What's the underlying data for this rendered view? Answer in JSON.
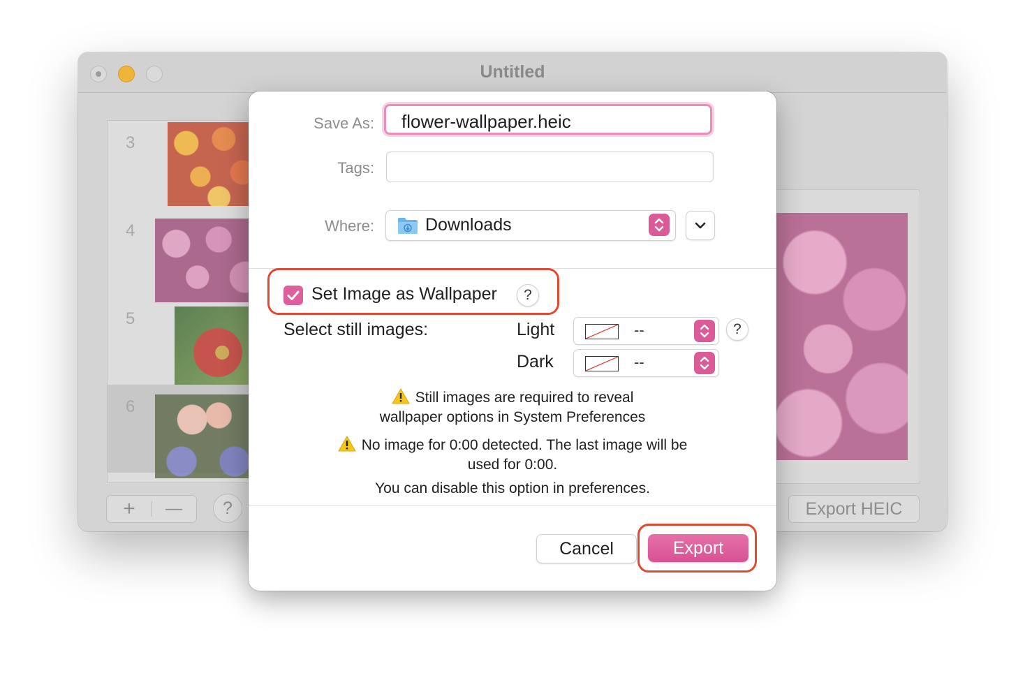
{
  "window": {
    "title": "Untitled",
    "thumbnails": [
      {
        "number": "3"
      },
      {
        "number": "4"
      },
      {
        "number": "5"
      },
      {
        "number": "6"
      }
    ],
    "add_label": "+",
    "remove_label": "—",
    "help_label": "?",
    "export_heic_label": "Export HEIC"
  },
  "dialog": {
    "save_as_label": "Save As:",
    "save_as_value": "flower-wallpaper.heic",
    "tags_label": "Tags:",
    "tags_value": "",
    "where_label": "Where:",
    "where_value": "Downloads",
    "set_wallpaper_label": "Set Image as Wallpaper",
    "set_wallpaper_checked": true,
    "help_label": "?",
    "select_still_label": "Select still images:",
    "light_label": "Light",
    "light_value": "--",
    "dark_label": "Dark",
    "dark_value": "--",
    "warning1_line1": "Still images are required to reveal",
    "warning1_line2": "wallpaper options in System Preferences",
    "warning2_line1": "No image for 0:00 detected. The last image will be",
    "warning2_line2": "used for 0:00.",
    "disable_note": "You can disable this option in preferences.",
    "cancel_label": "Cancel",
    "export_label": "Export"
  },
  "colors": {
    "accent": "#db5b98",
    "annotation_red": "#e04a33"
  }
}
